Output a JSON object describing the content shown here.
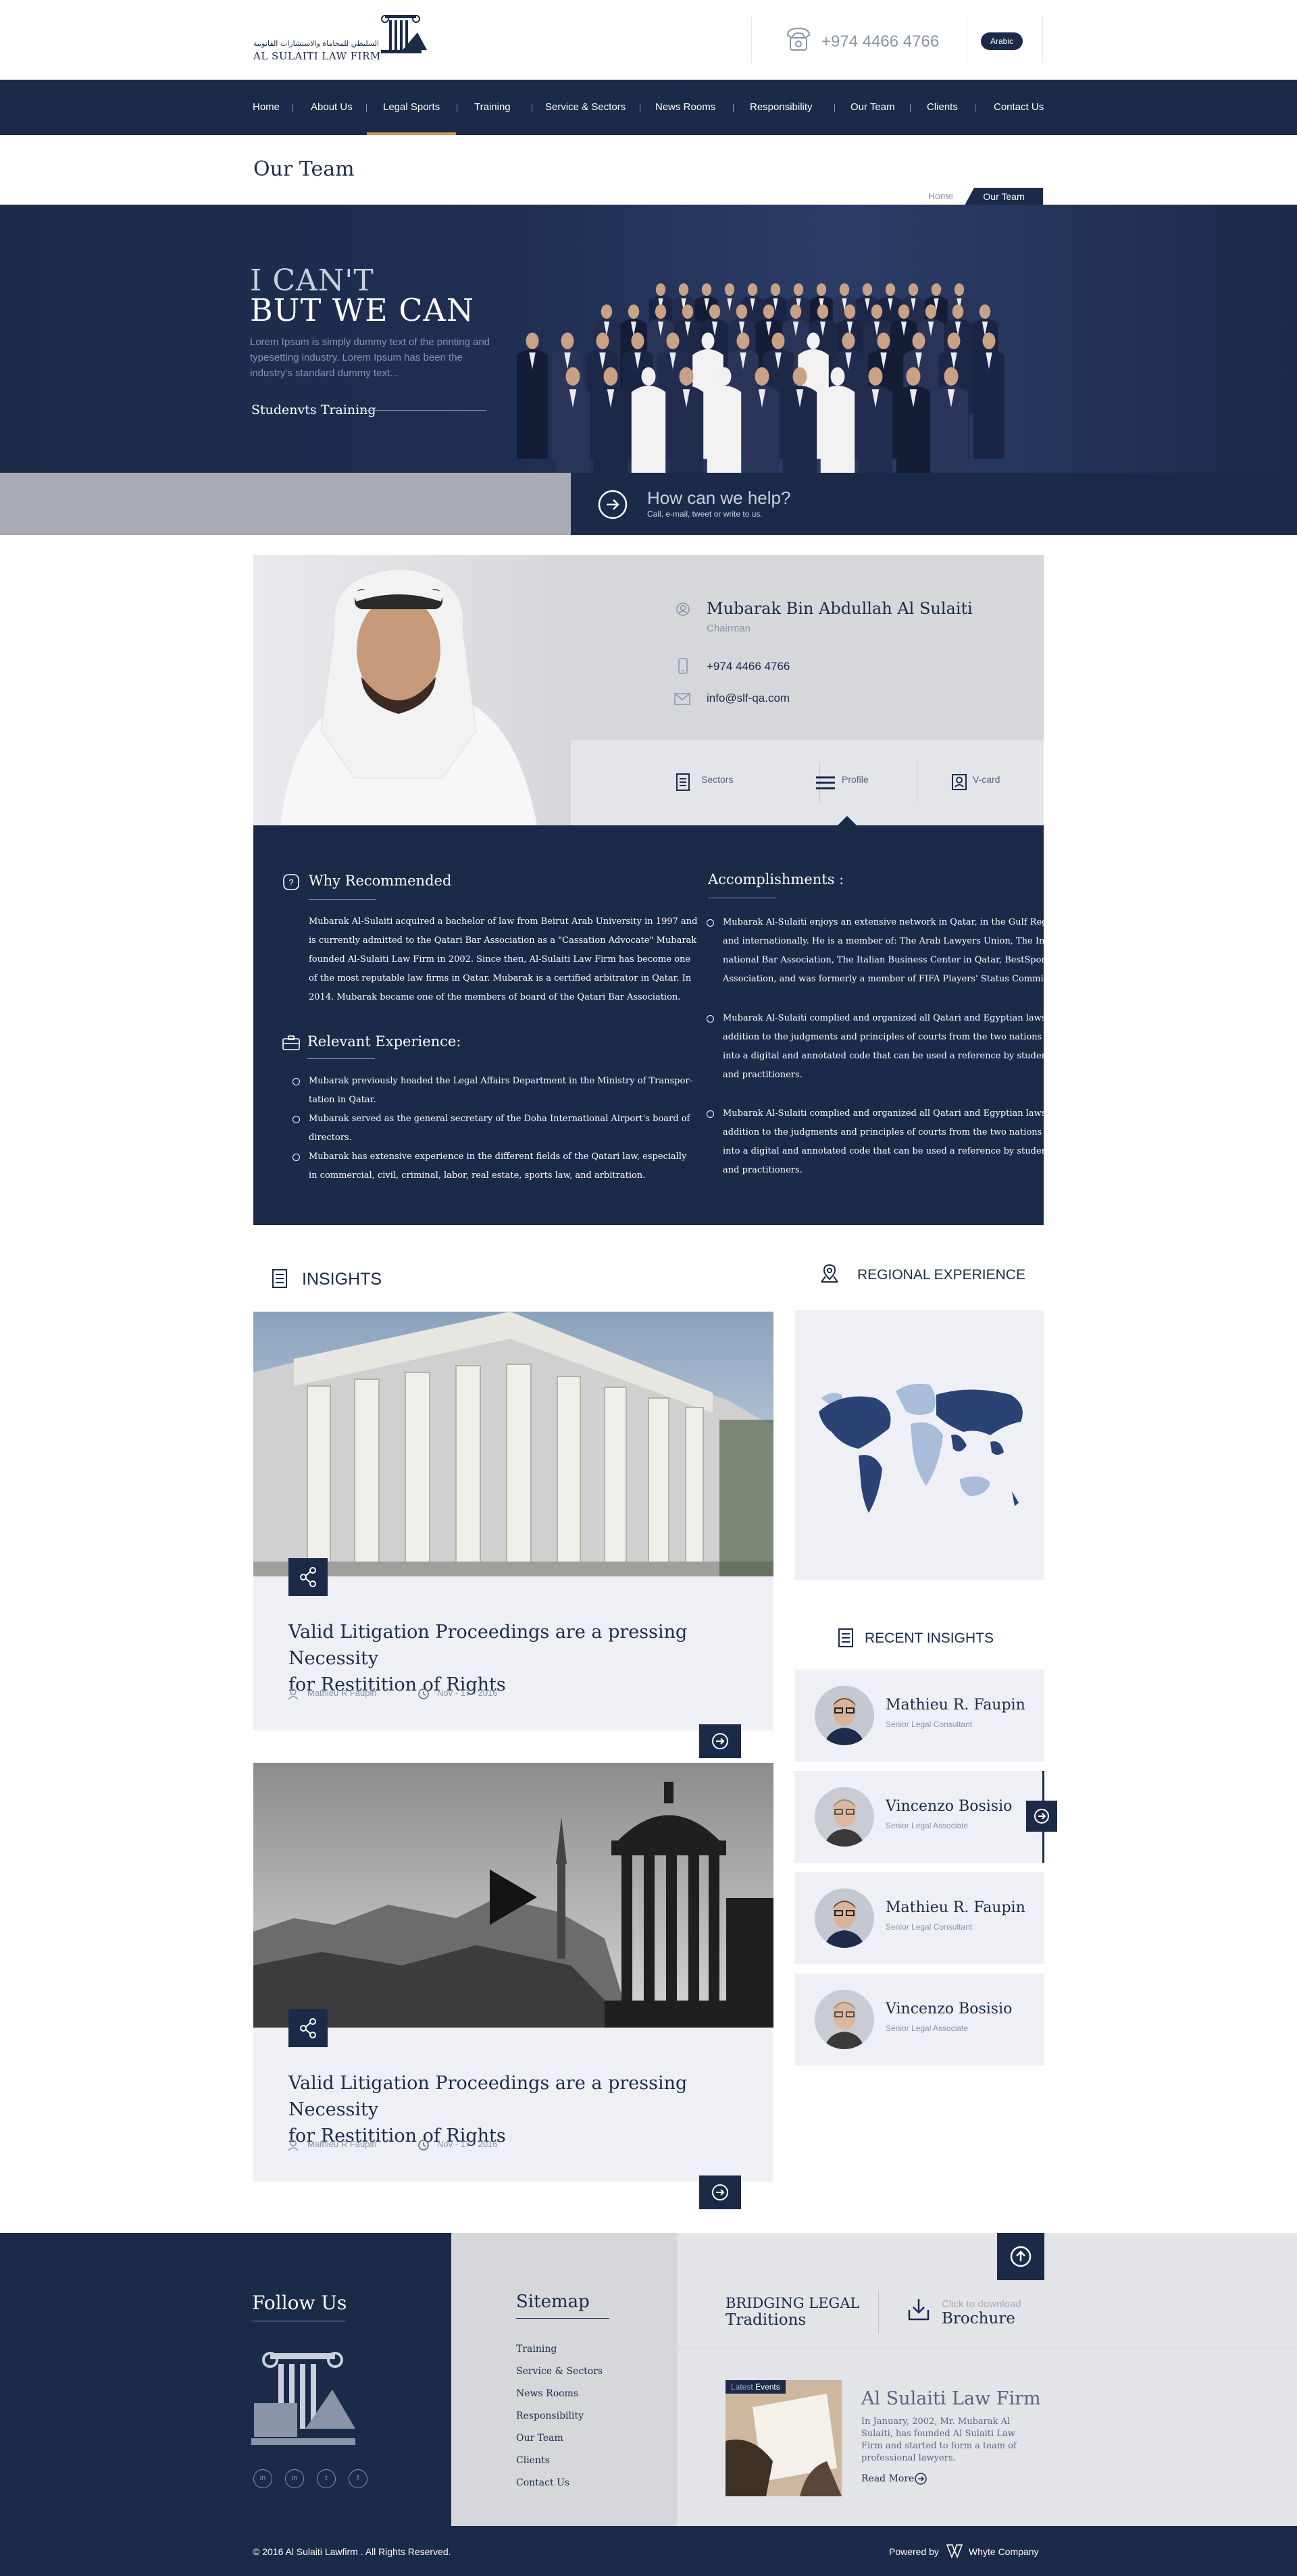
{
  "header": {
    "logo_arabic": "السليطي للمحاماة والاستشارات القانونية",
    "logo_name": "AL SULAITI LAW FIRM",
    "phone": "+974 4466 4766",
    "language": "Arabic"
  },
  "nav": {
    "items": [
      "Home",
      "About Us",
      "Legal Sports",
      "Training",
      "Service & Sectors",
      "News Rooms",
      "Responsibility",
      "Our Team",
      "Clients",
      "Contact Us"
    ],
    "active": "Legal Sports"
  },
  "title_bar": {
    "title": "Our Team",
    "breadcrumb_home": "Home",
    "breadcrumb_current": "Our Team"
  },
  "hero": {
    "line1": "I CAN'T",
    "line2": "BUT WE CAN",
    "text": "Lorem Ipsum is simply dummy text of the printing and typesetting industry. Lorem Ipsum has been the industry's standard dummy text...",
    "link": "Studenvts Training"
  },
  "help": {
    "title": "How can we help?",
    "subtitle": "Call, e-mail, tweet or write to us."
  },
  "profile": {
    "name": "Mubarak Bin Abdullah Al Sulaiti",
    "role": "Chairman",
    "phone": "+974 4466 4766",
    "email": "info@slf-qa.com",
    "tabs": [
      "Sectors",
      "Profile",
      "V-card"
    ],
    "active_tab": "Profile"
  },
  "details": {
    "why_title": "Why Recommended",
    "why_text": [
      "Mubarak Al-Sulaiti acquired a bachelor of law from Beirut Arab University in 1997 and",
      "is currently admitted to the Qatari Bar Association as a \"Cassation Advocate\" Mubarak",
      "founded Al-Sulaiti Law Firm in 2002. Since then, Al-Sulaiti Law Firm has become one",
      "of the most reputable law firms in Qatar. Mubarak is a certified arbitrator in Qatar. In",
      "2014. Mubarak became one of the members of board of the Qatari Bar Association."
    ],
    "exp_title": "Relevant Experience:",
    "exp_items": [
      [
        "Mubarak previously headed the Legal Affairs Department in the Ministry of Transpor-",
        "tation in Qatar."
      ],
      [
        "Mubarak served as the general secretary of the Doha International Airport's board of",
        "directors."
      ],
      [
        "Mubarak has extensive experience in the different fields of the Qatari law, especially",
        "in commercial, civil, criminal, labor, real estate, sports law, and arbitration."
      ]
    ],
    "acc_title": "Accomplishments :",
    "acc_items": [
      [
        "Mubarak Al-Sulaiti enjoys an extensive network in Qatar, in the Gulf Region",
        "and internationally. He is a member of: The Arab Lawyers Union, The Inter-",
        "national Bar Association, The Italian Business Center in Qatar, BestSport",
        "Association, and was formerly a member of FIFA Players' Status Committee."
      ],
      [
        "Mubarak Al-Sulaiti complied and organized all Qatari and Egyptian laws in",
        "addition to the judgments and principles of courts from the two nations",
        "into a digital and annotated code that can be used a reference by students",
        "and practitioners."
      ],
      [
        "Mubarak Al-Sulaiti complied and organized all Qatari and Egyptian laws in",
        "addition to the judgments and principles of courts from the two nations",
        "into a digital and annotated code that can be used a reference by students",
        "and practitioners."
      ]
    ]
  },
  "insights": {
    "title": "INSIGHTS",
    "cards": [
      {
        "title_l1": "Valid Litigation Proceedings are a pressing Necessity",
        "title_l2": "for Restitition of Rights",
        "author": "Mathieu R Faupin",
        "date": "Nov - 17 - 2016"
      },
      {
        "title_l1": "Valid Litigation Proceedings are a pressing Necessity",
        "title_l2": "for Restitition of Rights",
        "author": "Mathieu R Faupin",
        "date": "Nov - 17 - 2016"
      }
    ]
  },
  "regional": {
    "title": "REGIONAL EXPERIENCE"
  },
  "recent": {
    "title": "RECENT INSIGHTS",
    "items": [
      {
        "name": "Mathieu R. Faupin",
        "role": "Senior Legal Consultant"
      },
      {
        "name": "Vincenzo Bosisio",
        "role": "Senior Legal Associate"
      },
      {
        "name": "Mathieu R. Faupin",
        "role": "Senior Legal Consultant"
      },
      {
        "name": "Vincenzo Bosisio",
        "role": "Senior Legal Associate"
      }
    ]
  },
  "footer": {
    "follow": "Follow Us",
    "social": [
      "in",
      "in",
      "t",
      "f"
    ],
    "sitemap_title": "Sitemap",
    "sitemap": [
      "Training",
      "Service & Sectors",
      "News Rooms",
      "Responsibility",
      "Our Team",
      "Clients",
      "Contact Us"
    ],
    "bridging_l1": "BRIDGING LEGAL",
    "bridging_l2": "Traditions",
    "download_small": "Click to download",
    "download_big": "Brochure",
    "event_tag_a": "Latest",
    "event_tag_b": "Events",
    "event_title": "Al Sulaiti Law Firm",
    "event_text": "In January, 2002, Mr. Mubarak Al Sulaiti, has founded Al Sulaiti Law Firm and started to form a team of professional lawyers.",
    "read_more": "Read More",
    "copyright": "© 2016 Al Sulaiti Lawfirm . All Rights Reserved.",
    "powered": "Powered by",
    "company": "Whyte Company"
  },
  "colors": {
    "navy": "#1c2a4a",
    "accent": "#d09a5a",
    "light": "#eef0f5"
  }
}
